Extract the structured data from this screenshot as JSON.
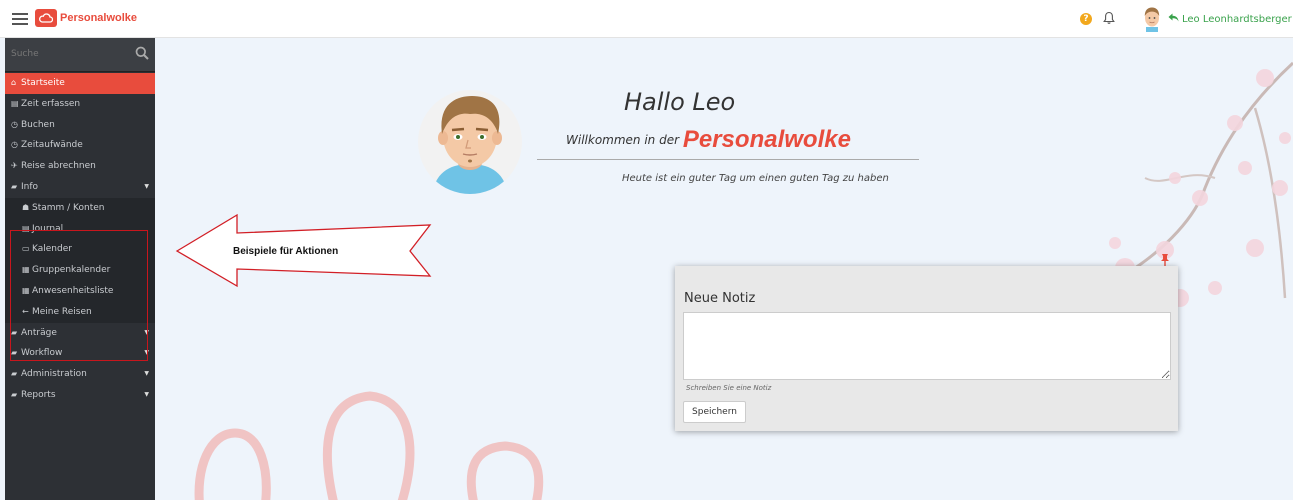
{
  "header": {
    "logo_text": "Personalwolke",
    "user_name": "Leo Leonhardtsberger",
    "help_glyph": "?"
  },
  "sidebar": {
    "search_placeholder": "Suche",
    "items": [
      {
        "label": "Startseite",
        "icon": "home-icon",
        "glyph": "⌂",
        "active": true
      },
      {
        "label": "Zeit erfassen",
        "icon": "table-icon",
        "glyph": "▤"
      },
      {
        "label": "Buchen",
        "icon": "clock-icon",
        "glyph": "◷"
      },
      {
        "label": "Zeitaufwände",
        "icon": "clock-icon",
        "glyph": "◷"
      },
      {
        "label": "Reise abrechnen",
        "icon": "plane-icon",
        "glyph": "✈"
      },
      {
        "label": "Info",
        "icon": "folder-open-icon",
        "glyph": "▰",
        "caret": true
      },
      {
        "label": "Stamm / Konten",
        "icon": "sitemap-icon",
        "glyph": "☗",
        "sub": true
      },
      {
        "label": "Journal",
        "icon": "list-icon",
        "glyph": "▤",
        "sub": true
      },
      {
        "label": "Kalender",
        "icon": "calendar-icon",
        "glyph": "▭",
        "sub": true
      },
      {
        "label": "Gruppenkalender",
        "icon": "table-icon",
        "glyph": "▦",
        "sub": true
      },
      {
        "label": "Anwesenheitsliste",
        "icon": "table-icon",
        "glyph": "▦",
        "sub": true
      },
      {
        "label": "Meine Reisen",
        "icon": "arrow-left-icon",
        "glyph": "←",
        "sub": true
      },
      {
        "label": "Anträge",
        "icon": "folder-icon",
        "glyph": "▰",
        "caret": true
      },
      {
        "label": "Workflow",
        "icon": "folder-icon",
        "glyph": "▰",
        "caret": true
      },
      {
        "label": "Administration",
        "icon": "folder-icon",
        "glyph": "▰",
        "caret": true
      },
      {
        "label": "Reports",
        "icon": "folder-icon",
        "glyph": "▰",
        "caret": true
      }
    ]
  },
  "main": {
    "greeting": "Hallo Leo",
    "welcome_prefix": "Willkommen in der",
    "brand": "Personalwolke",
    "tagline": "Heute ist ein guter Tag um einen guten Tag zu haben",
    "callout_label": "Beispiele für Aktionen"
  },
  "note": {
    "title": "Neue Notiz",
    "placeholder": "",
    "hint": "Schreiben Sie eine Notiz",
    "save_label": "Speichern"
  },
  "colors": {
    "brand_red": "#e84c3d",
    "sidebar_bg": "#2d3035",
    "user_green": "#3aa24c",
    "help_orange": "#f2a81d"
  }
}
